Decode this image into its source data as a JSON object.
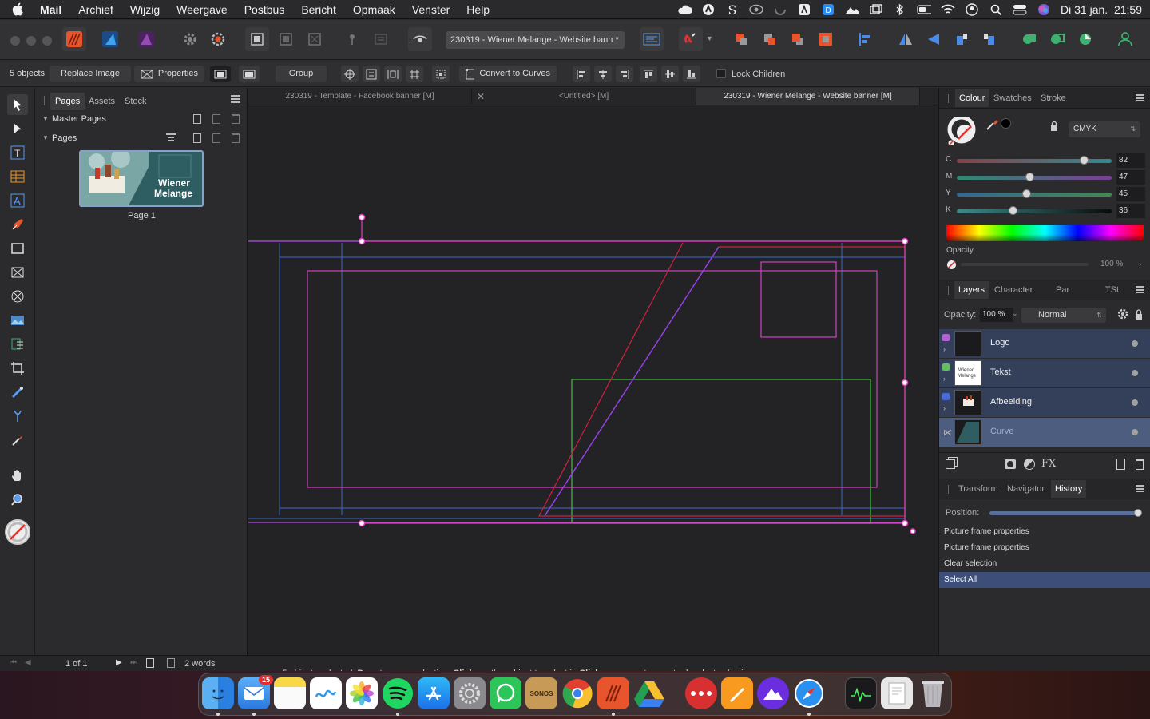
{
  "menubar": {
    "app": "Mail",
    "items": [
      "Archief",
      "Wijzig",
      "Weergave",
      "Postbus",
      "Bericht",
      "Opmaak",
      "Venster",
      "Help"
    ],
    "clock": "Di 31 jan.  21:59"
  },
  "toolbar": {
    "document_title": "230319 - Wiener Melange - Website bann",
    "modified_mark": "*"
  },
  "context_bar": {
    "selection_count": "5 objects",
    "replace_image": "Replace Image",
    "properties": "Properties",
    "group": "Group",
    "convert_to_curves": "Convert to Curves",
    "lock_children": "Lock Children"
  },
  "pages_panel": {
    "tabs": [
      "Pages",
      "Assets",
      "Stock"
    ],
    "master_pages": "Master Pages",
    "pages": "Pages",
    "thumbnail_text_line1": "Wiener",
    "thumbnail_text_line2": "Melange",
    "page_label": "Page 1"
  },
  "document_tabs": [
    {
      "label": "230319 - Template - Facebook banner [M]",
      "active": false
    },
    {
      "label": "<Untitled> [M]",
      "active": false
    },
    {
      "label": "230319 - Wiener Melange - Website banner [M]",
      "active": true
    }
  ],
  "colour_panel": {
    "tabs": [
      "Colour",
      "Swatches",
      "Stroke"
    ],
    "model": "CMYK",
    "channels": [
      {
        "label": "C",
        "value": "82",
        "level": 0.82
      },
      {
        "label": "M",
        "value": "47",
        "level": 0.47
      },
      {
        "label": "Y",
        "value": "45",
        "level": 0.45
      },
      {
        "label": "K",
        "value": "36",
        "level": 0.36
      }
    ],
    "opacity_label": "Opacity",
    "opacity_value": "100 %"
  },
  "layers_panel": {
    "tabs": [
      "Layers",
      "Character",
      "Par",
      "TSt"
    ],
    "opacity_label": "Opacity:",
    "opacity_value": "100 %",
    "blend_mode": "Normal",
    "layers": [
      {
        "name": "Logo",
        "color": "#b060d0"
      },
      {
        "name": "Tekst",
        "color": "#60c060"
      },
      {
        "name": "Afbeelding",
        "color": "#4a6ad8"
      },
      {
        "name": "Curve",
        "color": "#888888"
      }
    ]
  },
  "history_panel": {
    "tabs": [
      "Transform",
      "Navigator",
      "History"
    ],
    "position_label": "Position:",
    "position_level": 1.0,
    "entries": [
      "Picture frame properties",
      "Picture frame properties",
      "Clear selection",
      "Select All"
    ],
    "selected_index": 3
  },
  "statusbar": {
    "page_indicator": "1 of 1",
    "word_count": "2 words",
    "hint_1": "5 objects selected. ",
    "hint_2": "Drag",
    "hint_3": " to move selection. ",
    "hint_4": "Click",
    "hint_5": " another object to select it. ",
    "hint_6": "Click",
    "hint_7": " on an empty area to deselect selection."
  },
  "dock": {
    "mail_badge": "15",
    "sonos_label": "SONOS"
  },
  "colors": {
    "accent_blue": "#3d4f78",
    "selection_magenta": "#e040c0",
    "affinity_red": "#e8552c"
  }
}
